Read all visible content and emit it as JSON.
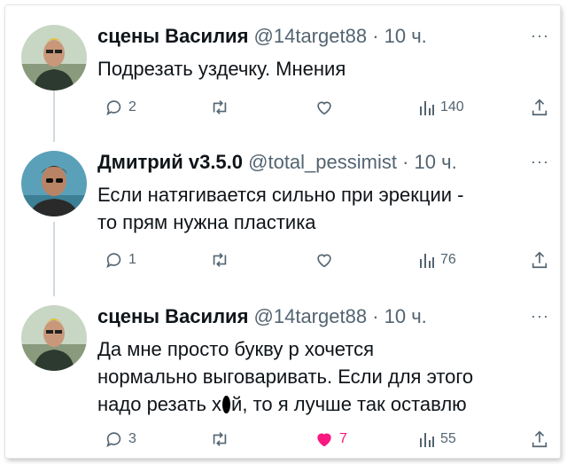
{
  "tweets": [
    {
      "name": "сцены Василия",
      "handle": "@14target88",
      "time": "· 10 ч.",
      "more": "···",
      "text": "Подрезать уздечку. Мнения",
      "replies": "2",
      "views": "140",
      "likes": ""
    },
    {
      "name": "Дмитрий v3.5.0",
      "handle": "@total_pessimist",
      "time": "· 10 ч.",
      "more": "···",
      "text": "Если натягивается сильно при эрекции -\nто прям нужна пластика",
      "replies": "1",
      "views": "76",
      "likes": ""
    },
    {
      "name": "сцены Василия",
      "handle": "@14target88",
      "time": "· 10 ч.",
      "more": "···",
      "text_before": "Да мне просто букву р хочется\nнормально выговаривать. Если для этого\nнадо резать х",
      "text_after": "й, то я лучше так оставлю",
      "replies": "3",
      "views": "55",
      "likes": "7"
    }
  ],
  "colors": {
    "text": "#0f1419",
    "secondary": "#536471",
    "like": "#f91880",
    "thread": "#cfd9de"
  }
}
